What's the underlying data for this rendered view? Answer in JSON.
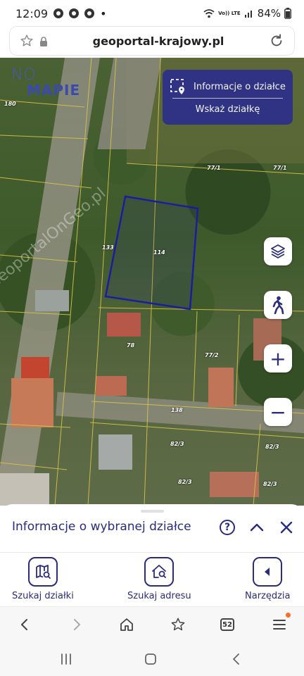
{
  "status": {
    "time": "12:09",
    "dot": "•",
    "network": "Vo)) LTE",
    "battery": "84%"
  },
  "browser": {
    "url": "geoportal-krajowy.pl"
  },
  "map": {
    "logo_top": "NO",
    "logo_bottom": "MAPIE",
    "watermark": "GeoportalOnGeo.pl",
    "parcel_card": {
      "info_label": "Informacje o działce",
      "select_label": "Wskaż działkę"
    },
    "labels": {
      "l180": "180",
      "l771a": "77/1",
      "l771b": "77/1",
      "l133": "133",
      "l114": "114",
      "l78": "78",
      "l772": "77/2",
      "l138": "138",
      "l823a": "82/3",
      "l823b": "82/3",
      "l823c": "82/3",
      "l823d": "82/3"
    },
    "controls": {
      "zoom_in": "+",
      "zoom_out": "−"
    }
  },
  "sheet": {
    "title": "Informacje o wybranej działce",
    "help": "?"
  },
  "tools": {
    "search_parcel": "Szukaj działki",
    "search_address": "Szukaj adresu",
    "tools_label": "Narzędzia"
  },
  "browser_nav": {
    "tab_count": "52"
  },
  "colors": {
    "brand": "#2a2c7c",
    "parcel_outline": "#1c1ca0",
    "card_bg": "#2d2f8a"
  }
}
